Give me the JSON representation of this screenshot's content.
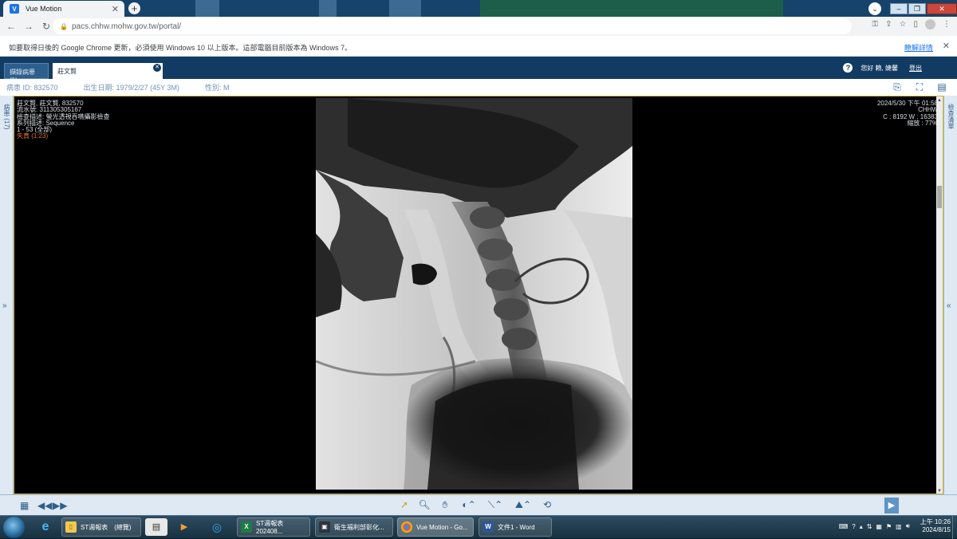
{
  "browser": {
    "tab_title": "Vue Motion",
    "new_tab_symbol": "+",
    "url": "pacs.chhw.mohw.gov.tw/portal/"
  },
  "infobar": {
    "message": "如要取得日後的 Google Chrome 更新，必須使用 Windows 10 以上版本。這部電腦目前版本為 Windows 7。",
    "more_link": "瞭解詳情"
  },
  "app": {
    "tabs": [
      {
        "label": "擷錄病患 (1)"
      },
      {
        "label": "莊文賢"
      }
    ],
    "user": {
      "greeting": "您好 賴, 婕馨",
      "logout": "登出"
    },
    "patient": {
      "id": "病患 ID: 832570",
      "dob": "出生日期: 1979/2/27 (45Y 3M)",
      "sex": "性別: M"
    },
    "left_panel_label": "病患 (17)",
    "right_panel_label": "檢查清單"
  },
  "viewer": {
    "overlay_left": [
      "莊文賢, 莊文賢, 832570",
      "流水號: 311305305167",
      "檢查描述: 螢光透視吞嚥攝影檢查",
      "系列描述: Sequence",
      "1 - 53 (全部)"
    ],
    "overlay_left_warning": "失真 (1:23)",
    "overlay_right": [
      "2024/5/30 下午 01:58",
      "CHHW",
      "C : 8192 W : 16383",
      "縮放 : 77%"
    ]
  },
  "taskbar": {
    "tasks": [
      {
        "label": "ST週報表　(總覽)"
      },
      {
        "label": "ST週報表202408..."
      },
      {
        "label": "衛生福利部彰化..."
      },
      {
        "label": "Vue Motion - Go..."
      },
      {
        "label": "文件1 - Word"
      }
    ],
    "clock_time": "上午 10:26",
    "clock_date": "2024/8/15"
  },
  "colors": {
    "app_header": "#123b63",
    "viewer_border": "#d6b828",
    "warning_text": "#e5762d",
    "overlay_text": "#d7dfe6"
  }
}
